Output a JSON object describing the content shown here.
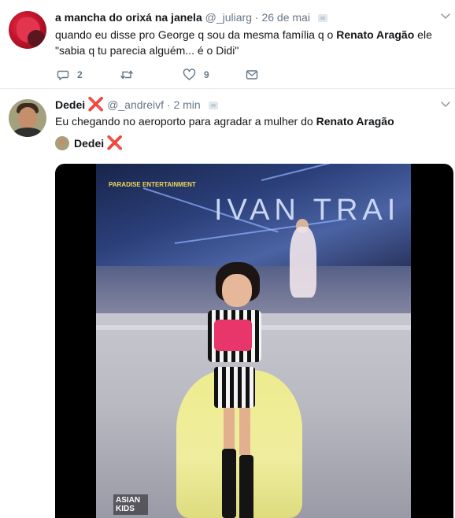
{
  "tweets": [
    {
      "display_name": "a mancha do orixá na janela",
      "handle": "@_juliarg",
      "separator": "·",
      "time": "26 de mai",
      "text_parts": [
        "quando eu disse pro George q sou da mesma família q o ",
        "Renato Aragão",
        " ele \"sabia q tu parecia alguém... é o Didi\""
      ],
      "actions": {
        "reply_icon": "reply-icon",
        "reply_count": "2",
        "retweet_icon": "retweet-icon",
        "like_icon": "heart-icon",
        "like_count": "9",
        "dm_icon": "envelope-icon"
      }
    },
    {
      "display_name": "Dedei",
      "name_emoji": "❌",
      "handle": "@_andreivf",
      "separator": "·",
      "time": "2 min",
      "text_parts": [
        "Eu chegando no aeroporto para agradar a mulher do ",
        "Renato Aragão"
      ],
      "quoted_author": {
        "display_name": "Dedei",
        "name_emoji": "❌"
      },
      "media": {
        "brand_text": "IVAN TRAI",
        "logo_text": "PARADISE ENTERTAINMENT",
        "watermark_text": "ASIAN KIDS"
      }
    }
  ],
  "colors": {
    "secondary_text": "#657786",
    "border": "#e6ecf0",
    "x_mark": "#e0243a"
  }
}
